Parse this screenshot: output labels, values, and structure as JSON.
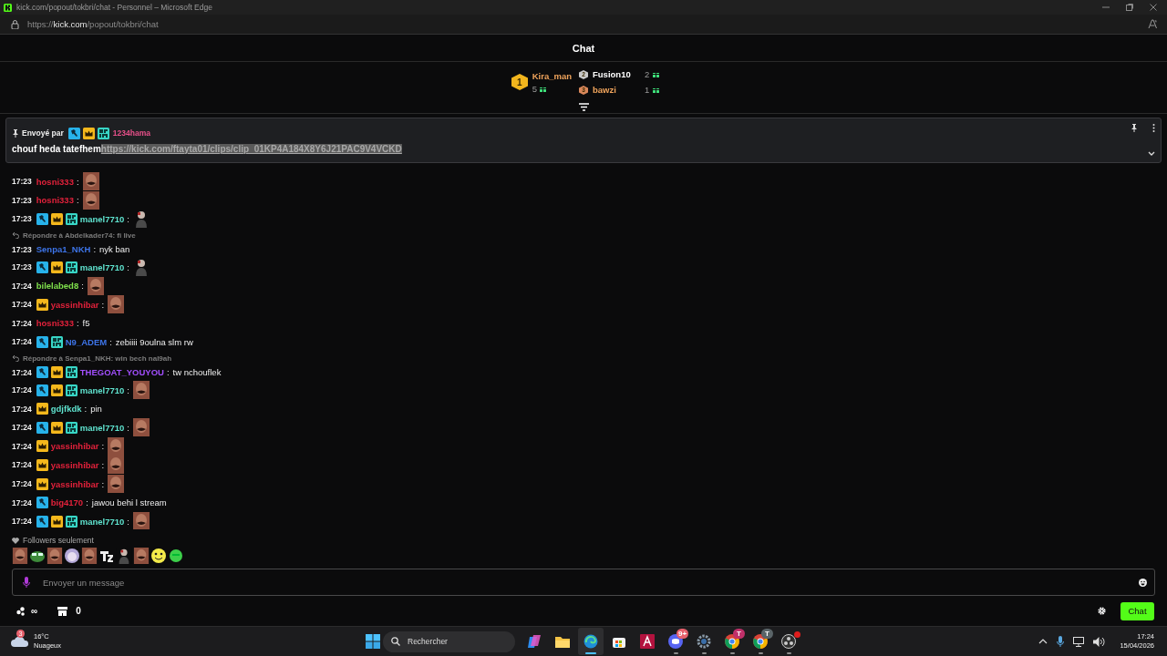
{
  "window": {
    "title": "kick.com/popout/tokbri/chat - Personnel – Microsoft Edge",
    "url": "https://**kick.com**/popout/tokbri/chat"
  },
  "header": {
    "title": "Chat"
  },
  "leaderboard": [
    {
      "rank": "1",
      "kind": "gold",
      "name": "Kira_man",
      "count": "5",
      "color": "#f0a45c"
    },
    {
      "rank": "2",
      "kind": "silver",
      "name": "Fusion10",
      "count": "2",
      "color": "#ffffff"
    },
    {
      "rank": "3",
      "kind": "bronze",
      "name": "bawzi",
      "count": "1",
      "color": "#f0a45c"
    }
  ],
  "pinned": {
    "label": "Envoyé par",
    "badges": [
      {
        "kind": "mod"
      },
      {
        "kind": "vip"
      },
      {
        "kind": "sub"
      }
    ],
    "sender": {
      "name": "1234hama",
      "color": "#e8508a"
    },
    "text": "chouf heda tatefhem",
    "link": "https://kick.com/ftayta01/clips/clip_01KP4A184X8Y6J21PAC9V4VCKD",
    "link_highlighted": true
  },
  "messages": [
    {
      "time": "17:23",
      "user": "hosni333",
      "color": "#e3213b",
      "colon": ":",
      "kind": "emote"
    },
    {
      "time": "17:23",
      "user": "hosni333",
      "color": "#e3213b",
      "colon": ":",
      "kind": "emote"
    },
    {
      "time": "17:23",
      "badges": [
        {
          "kind": "mod"
        },
        {
          "kind": "vip"
        },
        {
          "kind": "sub"
        }
      ],
      "user": "manel7710",
      "color": "#5fe3cf",
      "colon": ":",
      "kind": "avatar"
    },
    {
      "reply": "Répondre à Abdelkader74: fi live",
      "time": "17:23",
      "user": "Senpa1_NKH",
      "color": "#3d74e8",
      "colon": ":",
      "kind": "text",
      "text": "nyk ban"
    },
    {
      "time": "17:23",
      "badges": [
        {
          "kind": "mod"
        },
        {
          "kind": "vip"
        },
        {
          "kind": "sub"
        }
      ],
      "user": "manel7710",
      "color": "#5fe3cf",
      "colon": ":",
      "kind": "avatar"
    },
    {
      "time": "17:24",
      "user": "bilelabed8",
      "color": "#7fe04c",
      "colon": ":",
      "kind": "emote"
    },
    {
      "time": "17:24",
      "badges": [
        {
          "kind": "vip"
        }
      ],
      "user": "yassinhibar",
      "color": "#e3213b",
      "colon": ":",
      "kind": "emote"
    },
    {
      "time": "17:24",
      "user": "hosni333",
      "color": "#e3213b",
      "colon": ":",
      "kind": "text",
      "text": "f5"
    },
    {
      "time": "17:24",
      "badges": [
        {
          "kind": "mod"
        },
        {
          "kind": "sub"
        }
      ],
      "user": "N9_ADEM",
      "color": "#3d74e8",
      "colon": ":",
      "kind": "text",
      "text": "zebiiii 9oulna slm rw"
    },
    {
      "reply": "Répondre à Senpa1_NKH: win bech nal9ah",
      "time": "17:24",
      "badges": [
        {
          "kind": "mod"
        },
        {
          "kind": "vip"
        },
        {
          "kind": "sub"
        }
      ],
      "user": "THEGOAT_YOUYOU",
      "color": "#a34fff",
      "colon": ":",
      "kind": "text",
      "text": "tw nchouflek"
    },
    {
      "time": "17:24",
      "badges": [
        {
          "kind": "mod"
        },
        {
          "kind": "vip"
        },
        {
          "kind": "sub"
        }
      ],
      "user": "manel7710",
      "color": "#5fe3cf",
      "colon": ":",
      "kind": "emote"
    },
    {
      "time": "17:24",
      "badges": [
        {
          "kind": "vip"
        }
      ],
      "user": "gdjfkdk",
      "color": "#5fe3cf",
      "colon": ":",
      "kind": "text",
      "text": "pin"
    },
    {
      "time": "17:24",
      "badges": [
        {
          "kind": "mod"
        },
        {
          "kind": "vip"
        },
        {
          "kind": "sub"
        }
      ],
      "user": "manel7710",
      "color": "#5fe3cf",
      "colon": ":",
      "kind": "emote"
    },
    {
      "time": "17:24",
      "badges": [
        {
          "kind": "vip"
        }
      ],
      "user": "yassinhibar",
      "color": "#e3213b",
      "colon": ":",
      "kind": "emote"
    },
    {
      "time": "17:24",
      "badges": [
        {
          "kind": "vip"
        }
      ],
      "user": "yassinhibar",
      "color": "#e3213b",
      "colon": ":",
      "kind": "emote"
    },
    {
      "time": "17:24",
      "badges": [
        {
          "kind": "vip"
        }
      ],
      "user": "yassinhibar",
      "color": "#e3213b",
      "colon": ":",
      "kind": "emote"
    },
    {
      "time": "17:24",
      "badges": [
        {
          "kind": "mod"
        }
      ],
      "user": "big4170",
      "color": "#e3213b",
      "colon": ":",
      "kind": "text",
      "text": "jawou behi l stream"
    },
    {
      "time": "17:24",
      "badges": [
        {
          "kind": "mod"
        },
        {
          "kind": "vip"
        },
        {
          "kind": "sub"
        }
      ],
      "user": "manel7710",
      "color": "#5fe3cf",
      "colon": ":",
      "kind": "emote"
    }
  ],
  "followers_only": "Followers seulement",
  "emote_bar": [
    {
      "kind": "photo"
    },
    {
      "kind": "frog"
    },
    {
      "kind": "photo"
    },
    {
      "kind": "anime"
    },
    {
      "kind": "photo"
    },
    {
      "kind": "logo"
    },
    {
      "kind": "figure"
    },
    {
      "kind": "photo"
    },
    {
      "kind": "smiley"
    },
    {
      "kind": "blob"
    }
  ],
  "composer": {
    "placeholder": "Envoyer un message"
  },
  "footer": {
    "points": "∞",
    "store_count": "0",
    "send": "Chat"
  },
  "taskbar": {
    "weather": {
      "temp": "16°C",
      "condition": "Nuageux",
      "badge": "3"
    },
    "search": "Rechercher",
    "apps": [
      {
        "kind": "copilot",
        "selected": false,
        "running": false,
        "dot": false
      },
      {
        "kind": "folder",
        "selected": false,
        "running": false,
        "dot": false
      },
      {
        "kind": "edge",
        "selected": true,
        "running": true,
        "dot": false
      },
      {
        "kind": "store",
        "selected": false,
        "running": false,
        "dot": false
      },
      {
        "kind": "letter",
        "selected": false,
        "running": false,
        "dot": false
      },
      {
        "kind": "discord",
        "badge": {
          "text": "9+",
          "color": "#e8606c"
        },
        "selected": false,
        "running": true,
        "dot": false
      },
      {
        "kind": "settings",
        "selected": false,
        "running": true,
        "dot": false
      },
      {
        "kind": "chrome",
        "badge": {
          "text": "T",
          "color": "#c0306a"
        },
        "selected": false,
        "running": true,
        "dot": false
      },
      {
        "kind": "chrome",
        "badge": {
          "text": "T",
          "color": "#5a6468"
        },
        "selected": false,
        "running": true,
        "dot": false
      },
      {
        "kind": "obs",
        "selected": false,
        "running": true,
        "dot": true
      }
    ],
    "time": "17:24",
    "date": "15/04/2026"
  }
}
